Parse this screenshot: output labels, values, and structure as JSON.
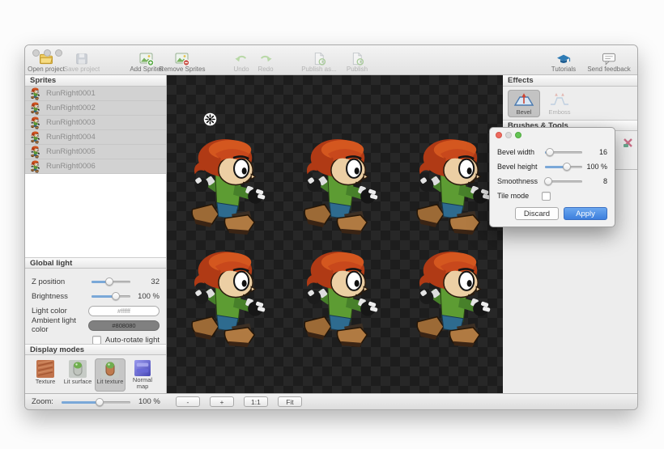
{
  "window": {
    "toolbar": {
      "items": [
        {
          "label": "Open project",
          "enabled": true
        },
        {
          "label": "Save project",
          "enabled": false
        },
        {
          "label": "Add Sprites",
          "enabled": true
        },
        {
          "label": "Remove Sprites",
          "enabled": true
        },
        {
          "label": "Undo",
          "enabled": false
        },
        {
          "label": "Redo",
          "enabled": false
        },
        {
          "label": "Publish as...",
          "enabled": false
        },
        {
          "label": "Publish",
          "enabled": false
        }
      ],
      "tutorials": "Tutorials",
      "send_feedback": "Send feedback"
    },
    "sprites_panel": {
      "header": "Sprites",
      "items": [
        "RunRight0001",
        "RunRight0002",
        "RunRight0003",
        "RunRight0004",
        "RunRight0005",
        "RunRight0006"
      ]
    },
    "global_light": {
      "header": "Global light",
      "z_position": {
        "label": "Z position",
        "value": "32"
      },
      "brightness": {
        "label": "Brightness",
        "value": "100 %"
      },
      "light_color": {
        "label": "Light color",
        "value": "#ffffff"
      },
      "ambient_light_color": {
        "label": "Ambient light color",
        "value": "#808080"
      },
      "auto_rotate": {
        "label": "Auto-rotate light",
        "checked": false
      }
    },
    "display_modes": {
      "header": "Display modes",
      "modes": [
        {
          "label": "Texture"
        },
        {
          "label": "Lit surface"
        },
        {
          "label": "Lit texture"
        },
        {
          "label": "Normal map"
        }
      ],
      "selected": "Lit texture"
    },
    "zoom_bar": {
      "label": "Zoom:",
      "value": "100 %",
      "zoom_out": "-",
      "zoom_in": "+",
      "one_to_one": "1:1",
      "fit": "Fit"
    },
    "effects_panel": {
      "header": "Effects",
      "bevel": "Bevel",
      "emboss": "Emboss",
      "selected": "Bevel"
    },
    "brushes_panel": {
      "header": "Brushes & Tools"
    }
  },
  "bevel_dialog": {
    "bevel_width": {
      "label": "Bevel width",
      "value": "16"
    },
    "bevel_height": {
      "label": "Bevel height",
      "value": "100 %"
    },
    "smoothness": {
      "label": "Smoothness",
      "value": "8"
    },
    "tile_mode": {
      "label": "Tile mode",
      "checked": false
    },
    "discard": "Discard",
    "apply": "Apply"
  },
  "colors": {
    "apply_button": "#4a8fe2",
    "slider_fill": "#7aa8d8",
    "canvas_checker_dark": "#1d1d1d",
    "canvas_checker_light": "#272727",
    "selected_item_bg": "#d2d2d2",
    "light_swatch": "#ffffff",
    "ambient_swatch": "#808080"
  }
}
